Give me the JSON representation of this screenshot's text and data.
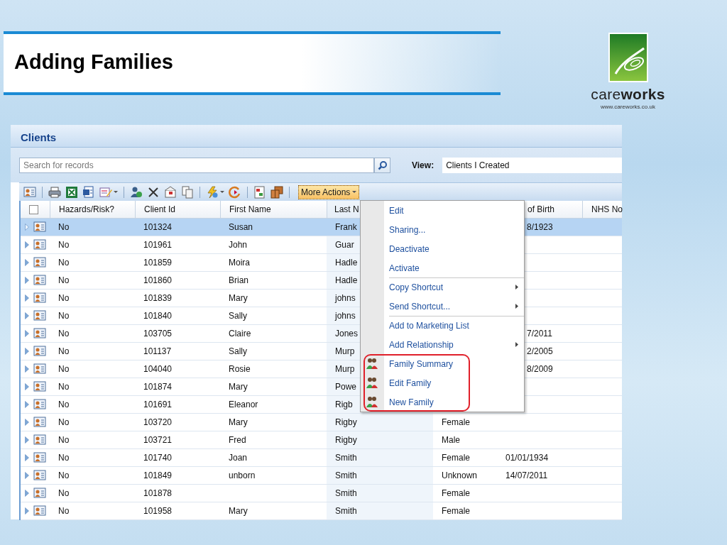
{
  "slide": {
    "title": "Adding Families",
    "logo": {
      "wordmark": "care**works**",
      "url": "www.careworks.co.uk"
    }
  },
  "panel": {
    "title": "Clients",
    "search": {
      "placeholder": "Search for records"
    },
    "view": {
      "label": "View:",
      "value": "Clients I Created"
    },
    "toolbar": {
      "more_actions": {
        "label": "More Actions",
        "open": true
      }
    },
    "menu": [
      {
        "label": "Edit",
        "kind": "plain",
        "submenu": false,
        "divider_before": false,
        "highlighted": false
      },
      {
        "label": "Sharing...",
        "kind": "plain",
        "submenu": false,
        "divider_before": false,
        "highlighted": false
      },
      {
        "label": "Deactivate",
        "kind": "plain",
        "submenu": false,
        "divider_before": false,
        "highlighted": false
      },
      {
        "label": "Activate",
        "kind": "plain",
        "submenu": false,
        "divider_before": false,
        "highlighted": false
      },
      {
        "label": "Copy Shortcut",
        "kind": "plain",
        "submenu": true,
        "divider_before": true,
        "highlighted": false
      },
      {
        "label": "Send Shortcut...",
        "kind": "plain",
        "submenu": true,
        "divider_before": false,
        "highlighted": false
      },
      {
        "label": "Add to Marketing List",
        "kind": "plain",
        "submenu": false,
        "divider_before": true,
        "highlighted": false
      },
      {
        "label": "Add Relationship",
        "kind": "plain",
        "submenu": true,
        "divider_before": false,
        "highlighted": false
      },
      {
        "label": "Family Summary",
        "kind": "family",
        "submenu": false,
        "divider_before": false,
        "highlighted": true
      },
      {
        "label": "Edit Family",
        "kind": "family",
        "submenu": false,
        "divider_before": false,
        "highlighted": true
      },
      {
        "label": "New Family",
        "kind": "family",
        "submenu": false,
        "divider_before": false,
        "highlighted": true
      }
    ],
    "table": {
      "header": {
        "checked": false,
        "under_menu": true,
        "hazards": "Hazards/Risk?",
        "client_id": "Client Id",
        "first_name": "First Name",
        "last_name": "Last N",
        "date_of_birth": "of Birth",
        "nhs_no": "NHS No"
      },
      "rows": [
        {
          "selected": true,
          "under_menu": true,
          "hazards": "No",
          "client_id": "101324",
          "first_name": "Susan",
          "last_name": "Frank",
          "date_of_birth": "8/1923"
        },
        {
          "selected": false,
          "hazards": "No",
          "client_id": "101961",
          "first_name": "John",
          "last_name": "Guar"
        },
        {
          "selected": false,
          "hazards": "No",
          "client_id": "101859",
          "first_name": "Moira",
          "last_name": "Hadle"
        },
        {
          "selected": false,
          "hazards": "No",
          "client_id": "101860",
          "first_name": "Brian",
          "last_name": "Hadle"
        },
        {
          "selected": false,
          "hazards": "No",
          "client_id": "101839",
          "first_name": "Mary",
          "last_name": "johns"
        },
        {
          "selected": false,
          "hazards": "No",
          "client_id": "101840",
          "first_name": "Sally",
          "last_name": "johns"
        },
        {
          "selected": false,
          "under_menu": true,
          "hazards": "No",
          "client_id": "103705",
          "first_name": "Claire",
          "last_name": "Jones",
          "date_of_birth": "7/2011"
        },
        {
          "selected": false,
          "under_menu": true,
          "hazards": "No",
          "client_id": "101137",
          "first_name": "Sally",
          "last_name": "Murp",
          "date_of_birth": "2/2005"
        },
        {
          "selected": false,
          "under_menu": true,
          "hazards": "No",
          "client_id": "104040",
          "first_name": "Rosie",
          "last_name": "Murp",
          "date_of_birth": "8/2009"
        },
        {
          "selected": false,
          "hazards": "No",
          "client_id": "101874",
          "first_name": "Mary",
          "last_name": "Powe"
        },
        {
          "selected": false,
          "hazards": "No",
          "client_id": "101691",
          "first_name": "Eleanor",
          "last_name": "Rigb"
        },
        {
          "selected": false,
          "hazards": "No",
          "client_id": "103720",
          "first_name": "Mary",
          "last_name": "Rigby",
          "gender": "Female"
        },
        {
          "selected": false,
          "hazards": "No",
          "client_id": "103721",
          "first_name": "Fred",
          "last_name": "Rigby",
          "gender": "Male"
        },
        {
          "selected": false,
          "under_menu": false,
          "hazards": "No",
          "client_id": "101740",
          "first_name": "Joan",
          "last_name": "Smith",
          "gender": "Female",
          "date_of_birth": "01/01/1934"
        },
        {
          "selected": false,
          "under_menu": false,
          "hazards": "No",
          "client_id": "101849",
          "first_name": "unborn",
          "last_name": "Smith",
          "gender": "Unknown",
          "date_of_birth": "14/07/2011"
        },
        {
          "selected": false,
          "hazards": "No",
          "client_id": "101878",
          "last_name": "Smith",
          "gender": "Female"
        },
        {
          "selected": false,
          "hazards": "No",
          "client_id": "101958",
          "first_name": "Mary",
          "last_name": "Smith",
          "gender": "Female"
        }
      ]
    }
  }
}
